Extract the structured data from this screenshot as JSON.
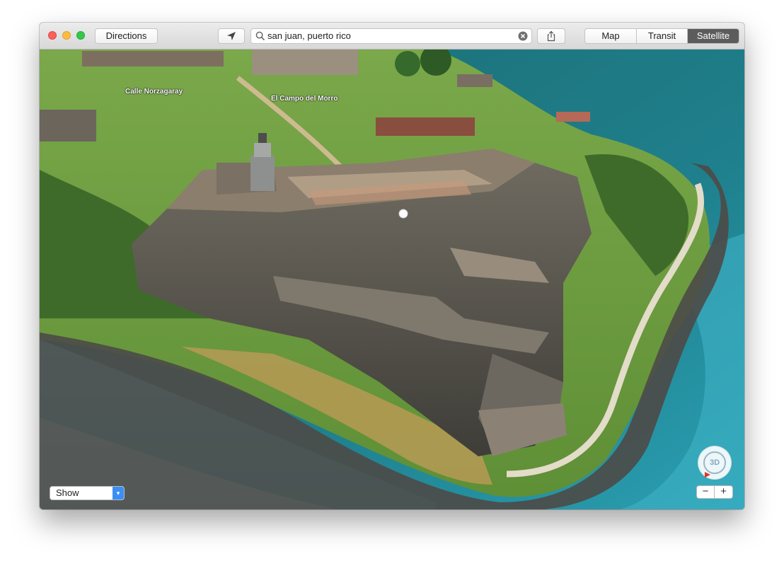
{
  "toolbar": {
    "directions_label": "Directions",
    "location_icon": "location-arrow-icon",
    "search": {
      "value": "san juan, puerto rico",
      "icon": "search-icon",
      "clear_icon": "clear-icon"
    },
    "share_icon": "share-icon",
    "map_modes": [
      {
        "label": "Map",
        "active": false
      },
      {
        "label": "Transit",
        "active": false
      },
      {
        "label": "Satellite",
        "active": true
      }
    ]
  },
  "map": {
    "labels": [
      "Calle Norzagaray",
      "El Campo del Morro"
    ],
    "show_menu": {
      "selected": "Show"
    },
    "compass_label": "3D",
    "zoom": {
      "out_label": "−",
      "in_label": "+"
    }
  },
  "colors": {
    "titlebar": "#e3e3e3",
    "active_segment": "#5c5c5c",
    "ocean": "#1e6f79",
    "grass": "#6d9a3e",
    "fort_stone": "#5d5a52",
    "accent_blue": "#3a8ff5"
  }
}
